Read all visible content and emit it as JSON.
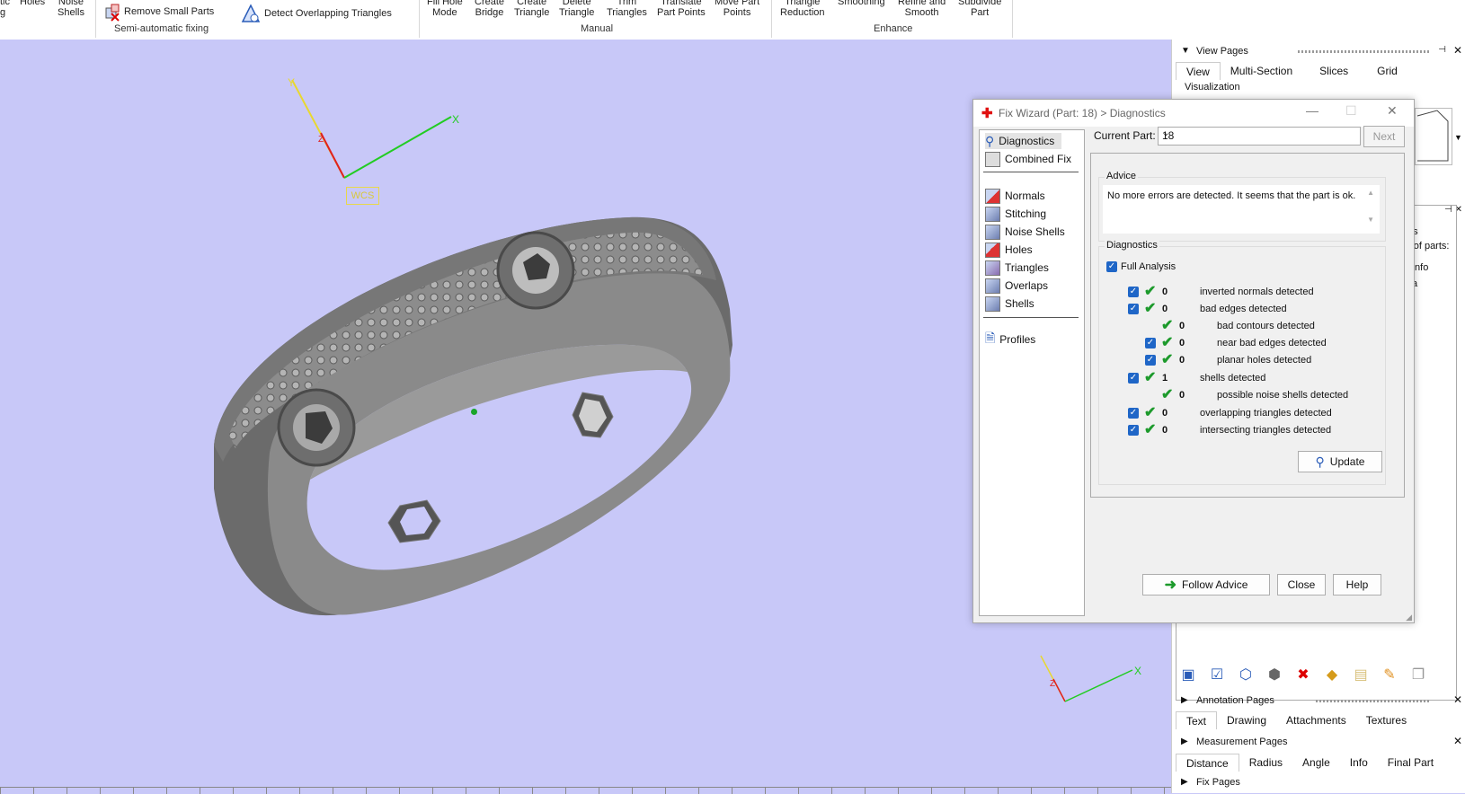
{
  "ribbon": {
    "left_partial": [
      "tic",
      "g"
    ],
    "holes": "Holes",
    "noise_shells": [
      "Noise",
      "Shells"
    ],
    "remove_small_parts": "Remove Small Parts",
    "detect_overlapping": "Detect Overlapping Triangles",
    "semi_auto_label": "Semi-automatic fixing",
    "manual_items": [
      [
        "Fill Hole",
        "Mode"
      ],
      [
        "Create",
        "Bridge"
      ],
      [
        "Create",
        "Triangle"
      ],
      [
        "Delete",
        "Triangle"
      ],
      [
        "Trim",
        "Triangles"
      ],
      [
        "Translate",
        "Part Points"
      ],
      [
        "Move Part",
        "Points"
      ]
    ],
    "manual_label": "Manual",
    "enhance_items": [
      [
        "Triangle",
        "Reduction"
      ],
      [
        "Smoothing",
        ""
      ],
      [
        "Refine and",
        "Smooth"
      ],
      [
        "Subdivide",
        "Part"
      ]
    ],
    "enhance_label": "Enhance"
  },
  "viewport": {
    "wcs_label": "WCS",
    "axis_x": "X",
    "axis_y": "Y",
    "axis_z": "Z",
    "colors": {
      "background": "#c8c8f8",
      "x_axis": "#22cc22",
      "y_axis": "#e8d830",
      "z_axis": "#e02020"
    }
  },
  "right_panel": {
    "view_pages_title": "View Pages",
    "view_tabs": [
      "View",
      "Multi-Section",
      "Slices",
      "Grid"
    ],
    "visualization_label": "Visualization",
    "parts_partial": [
      "es",
      "r of parts:",
      "Info",
      "a"
    ],
    "toolbar_icons": [
      "cube-select-icon",
      "cube-check-icon",
      "cube-wire-icon",
      "cube-outline-icon",
      "cube-delete-icon",
      "cube-color-icon",
      "page-icon",
      "pencil-icon",
      "copy-icon"
    ],
    "annotation_title": "Annotation Pages",
    "annotation_tabs": [
      "Text",
      "Drawing",
      "Attachments",
      "Textures"
    ],
    "measurement_title": "Measurement Pages",
    "measurement_tabs": [
      "Distance",
      "Radius",
      "Angle",
      "Info",
      "Final Part"
    ],
    "fix_pages_title": "Fix Pages"
  },
  "dialog": {
    "title": "Fix Wizard (Part: 18) > Diagnostics",
    "nav": {
      "top": [
        "Diagnostics",
        "Combined Fix"
      ],
      "middle": [
        "Normals",
        "Stitching",
        "Noise Shells",
        "Holes",
        "Triangles",
        "Overlaps",
        "Shells"
      ],
      "bottom": [
        "Profiles"
      ]
    },
    "current_part_label": "Current Part:",
    "current_part_value": "18",
    "next_label": "Next",
    "advice_legend": "Advice",
    "advice_text": "No more errors are detected. It seems that the part is ok.",
    "diagnostics_legend": "Diagnostics",
    "full_analysis_label": "Full Analysis",
    "checks": [
      {
        "count": "0",
        "label": "inverted normals detected"
      },
      {
        "count": "0",
        "label": "bad edges detected"
      },
      {
        "count": "0",
        "label": "bad contours detected"
      },
      {
        "count": "0",
        "label": "near bad edges detected"
      },
      {
        "count": "0",
        "label": "planar holes detected"
      },
      {
        "count": "1",
        "label": "shells detected"
      },
      {
        "count": "0",
        "label": "possible noise shells detected"
      },
      {
        "count": "0",
        "label": "overlapping triangles detected"
      },
      {
        "count": "0",
        "label": "intersecting triangles detected"
      }
    ],
    "update_label": "Update",
    "follow_advice_label": "Follow Advice",
    "close_label": "Close",
    "help_label": "Help"
  }
}
